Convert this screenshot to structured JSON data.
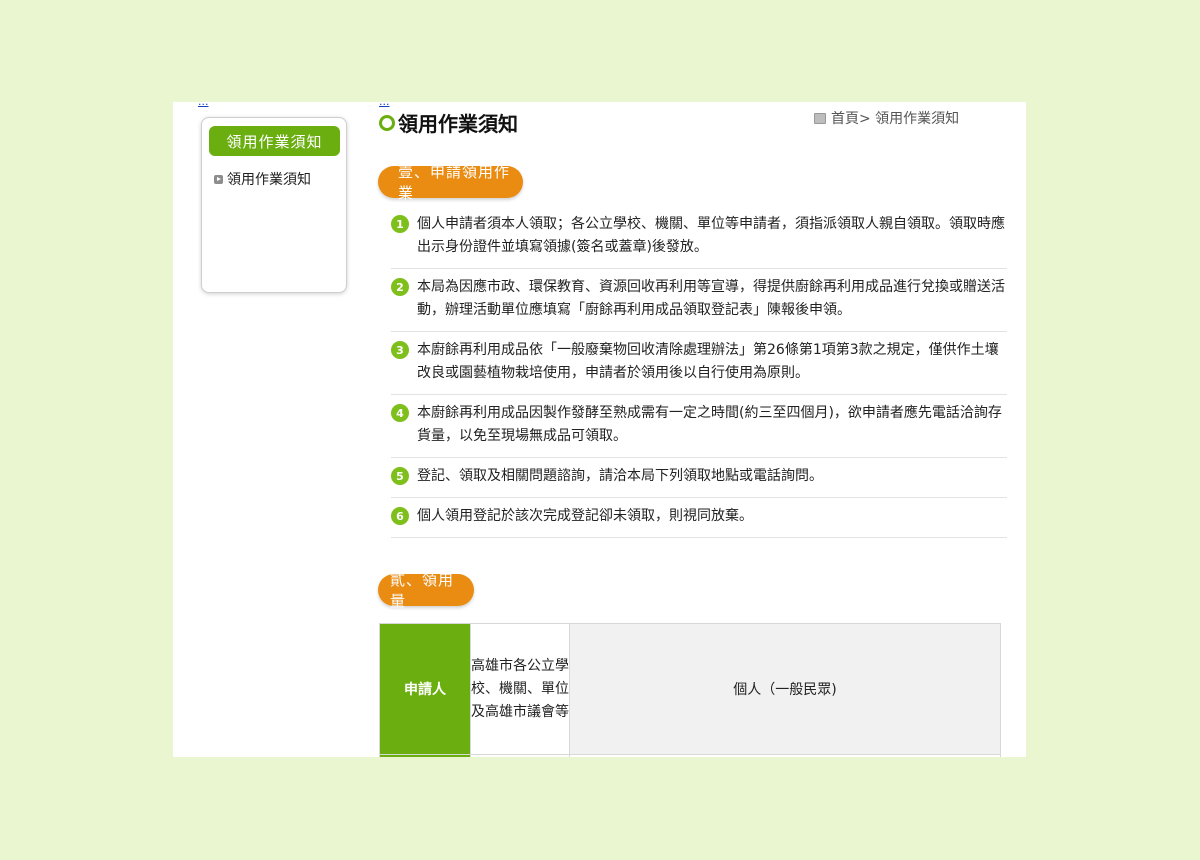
{
  "skip_links": [
    "...",
    "..."
  ],
  "sidebar": {
    "title": "領用作業須知",
    "items": [
      {
        "label": "領用作業須知",
        "icon": "arrow-square-icon"
      }
    ]
  },
  "page": {
    "title": "領用作業須知",
    "breadcrumb": "首頁> 領用作業須知"
  },
  "section1": {
    "title": "壹、申請領用作業",
    "items": [
      {
        "num": "1",
        "text": "個人申請者須本人領取；各公立學校、機關、單位等申請者，須指派領取人親自領取。領取時應出示身份證件並填寫領據(簽名或蓋章)後發放。"
      },
      {
        "num": "2",
        "text": "本局為因應市政、環保教育、資源回收再利用等宣導，得提供廚餘再利用成品進行兌換或贈送活動，辦理活動單位應填寫「廚餘再利用成品領取登記表」陳報後申領。"
      },
      {
        "num": "3",
        "text": "本廚餘再利用成品依「一般廢棄物回收清除處理辦法」第26條第1項第3款之規定，僅供作土壤改良或園藝植物栽培使用，申請者於領用後以自行使用為原則。"
      },
      {
        "num": "4",
        "text": "本廚餘再利用成品因製作發酵至熟成需有一定之時間(約三至四個月)，欲申請者應先電話洽詢存貨量，以免至現場無成品可領取。"
      },
      {
        "num": "5",
        "text": "登記、領取及相關問題諮詢，請洽本局下列領取地點或電話詢問。"
      },
      {
        "num": "6",
        "text": "個人領用登記於該次完成登記卻未領取，則視同放棄。"
      }
    ]
  },
  "section2": {
    "title": "貳、領用量",
    "table": {
      "row_header": "申請人",
      "col_school": "高雄市各公立學校、機關、單位及高雄市議會等",
      "col_person": "個人（一般民眾)"
    }
  }
}
